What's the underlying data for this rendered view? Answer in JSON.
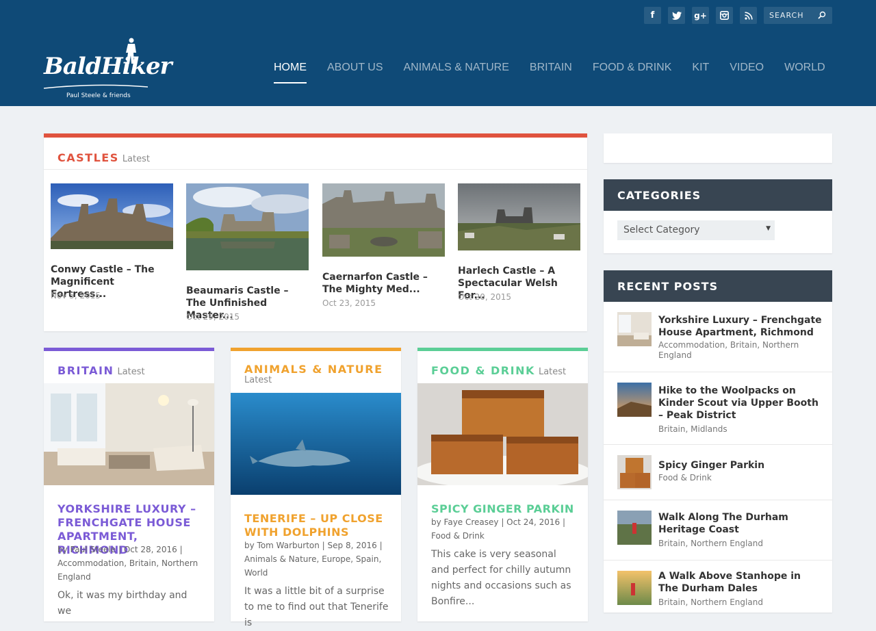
{
  "brand": {
    "logo_text": "BaldHiker",
    "tagline": "Paul Steele & friends"
  },
  "social": [
    "facebook-icon",
    "twitter-icon",
    "google-plus-icon",
    "instagram-icon",
    "rss-icon"
  ],
  "search": {
    "placeholder": "SEARCH"
  },
  "nav": [
    "HOME",
    "ABOUT US",
    "ANIMALS & NATURE",
    "BRITAIN",
    "FOOD & DRINK",
    "KIT",
    "VIDEO",
    "WORLD"
  ],
  "colors": {
    "header": "#0f4a77",
    "castles": "#e0533e",
    "britain": "#7b5bd6",
    "animals": "#f0a22e",
    "food": "#5bce96",
    "sidebar_head": "#384552"
  },
  "castles": {
    "heading": "CASTLES",
    "latest": "Latest",
    "posts": [
      {
        "title": "Conwy Castle – The Magnificent Fortress...",
        "date": "Nov 5, 2015"
      },
      {
        "title": "Beaumaris Castle – The Unfinished Master...",
        "date": "Oct 29, 2015"
      },
      {
        "title": "Caernarfon Castle – The Mighty Med...",
        "date": "Oct 23, 2015"
      },
      {
        "title": "Harlech Castle – A Spectacular Welsh For...",
        "date": "Oct 20, 2015"
      }
    ]
  },
  "britain": {
    "heading": "BRITAIN",
    "latest": "Latest",
    "title": "YORKSHIRE LUXURY – FRENCHGATE HOUSE APARTMENT, RICHMOND",
    "meta": "by Paul Steele | Oct 28, 2016 | Accommodation, Britain, Northern England",
    "excerpt": "Ok, it was my birthday and we"
  },
  "animals": {
    "heading": "ANIMALS & NATURE",
    "latest": "Latest",
    "title": "TENERIFE – UP CLOSE WITH DOLPHINS",
    "meta": "by Tom Warburton | Sep 8, 2016 | Animals & Nature, Europe, Spain, World",
    "excerpt": "It was a little bit of a surprise to me to find out that Tenerife is"
  },
  "food": {
    "heading": "FOOD & DRINK",
    "latest": "Latest",
    "title": "SPICY GINGER PARKIN",
    "meta": "by Faye Creasey | Oct 24, 2016 | Food & Drink",
    "excerpt": "This cake is very seasonal and perfect for chilly autumn nights and occasions such as Bonfire..."
  },
  "sidebar": {
    "categories_heading": "CATEGORIES",
    "select_value": "Select Category",
    "recent_heading": "RECENT POSTS",
    "recent": [
      {
        "title": "Yorkshire Luxury – Frenchgate House Apartment, Richmond",
        "cats": "Accommodation, Britain, Northern England"
      },
      {
        "title": "Hike to the Woolpacks on Kinder Scout via Upper Booth – Peak District",
        "cats": "Britain, Midlands"
      },
      {
        "title": "Spicy Ginger Parkin",
        "cats": "Food & Drink"
      },
      {
        "title": "Walk Along The Durham Heritage Coast",
        "cats": "Britain, Northern England"
      },
      {
        "title": "A Walk Above Stanhope in The Durham Dales",
        "cats": "Britain, Northern England"
      }
    ]
  }
}
